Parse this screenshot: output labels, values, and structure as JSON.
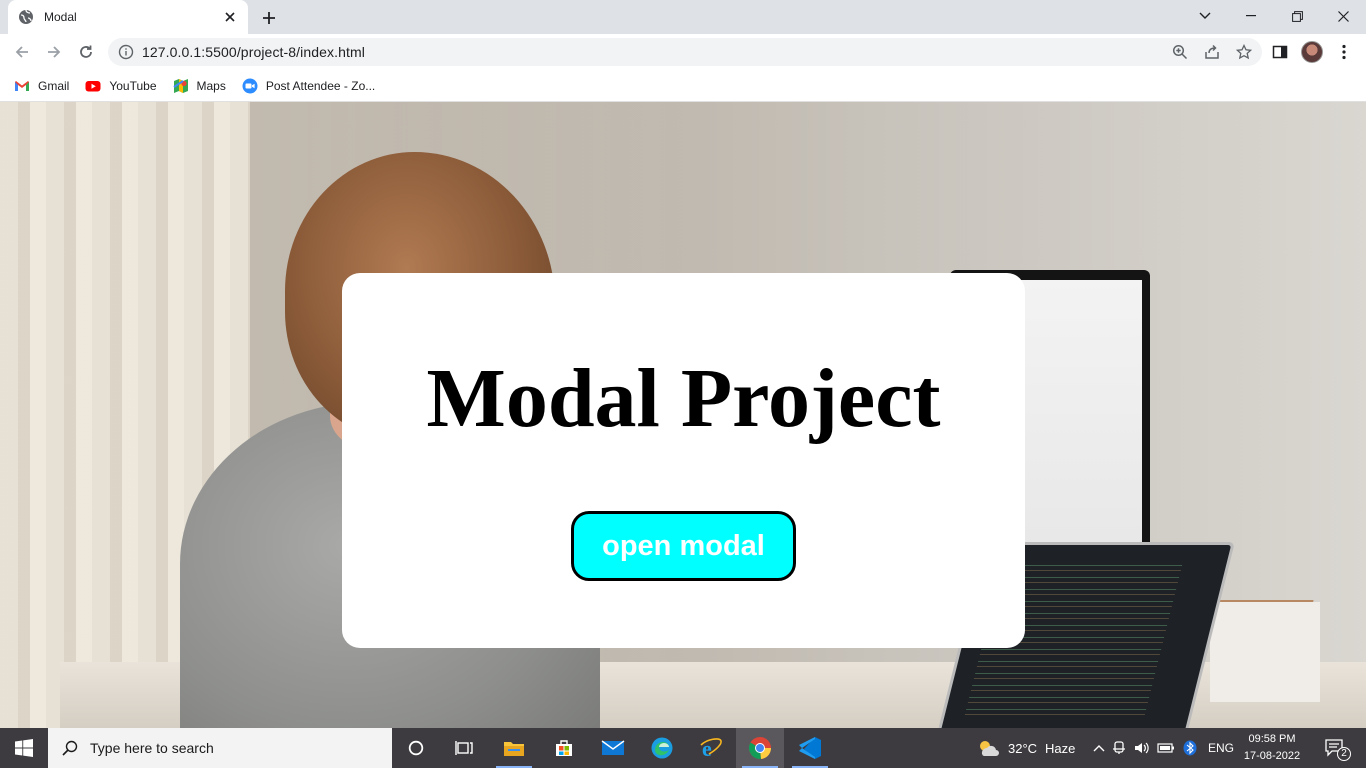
{
  "browser": {
    "tab": {
      "title": "Modal"
    },
    "address": {
      "url": "127.0.0.1:5500/project-8/index.html"
    },
    "bookmarks": [
      {
        "label": "Gmail",
        "icon": "gmail-icon"
      },
      {
        "label": "YouTube",
        "icon": "youtube-icon"
      },
      {
        "label": "Maps",
        "icon": "maps-icon"
      },
      {
        "label": "Post Attendee - Zo...",
        "icon": "zoom-icon"
      }
    ]
  },
  "page": {
    "modal": {
      "title": "Modal Project",
      "button_label": "open modal",
      "button_color": "#00ffff"
    }
  },
  "taskbar": {
    "search_placeholder": "Type here to search",
    "weather": {
      "temp": "32°C",
      "condition": "Haze"
    },
    "language": "ENG",
    "time": "09:58 PM",
    "date": "17-08-2022",
    "notifications": "2",
    "apps": [
      "task-view-icon",
      "file-explorer-icon",
      "store-icon",
      "mail-icon",
      "edge-icon",
      "internet-explorer-icon",
      "chrome-icon",
      "vscode-icon"
    ]
  }
}
